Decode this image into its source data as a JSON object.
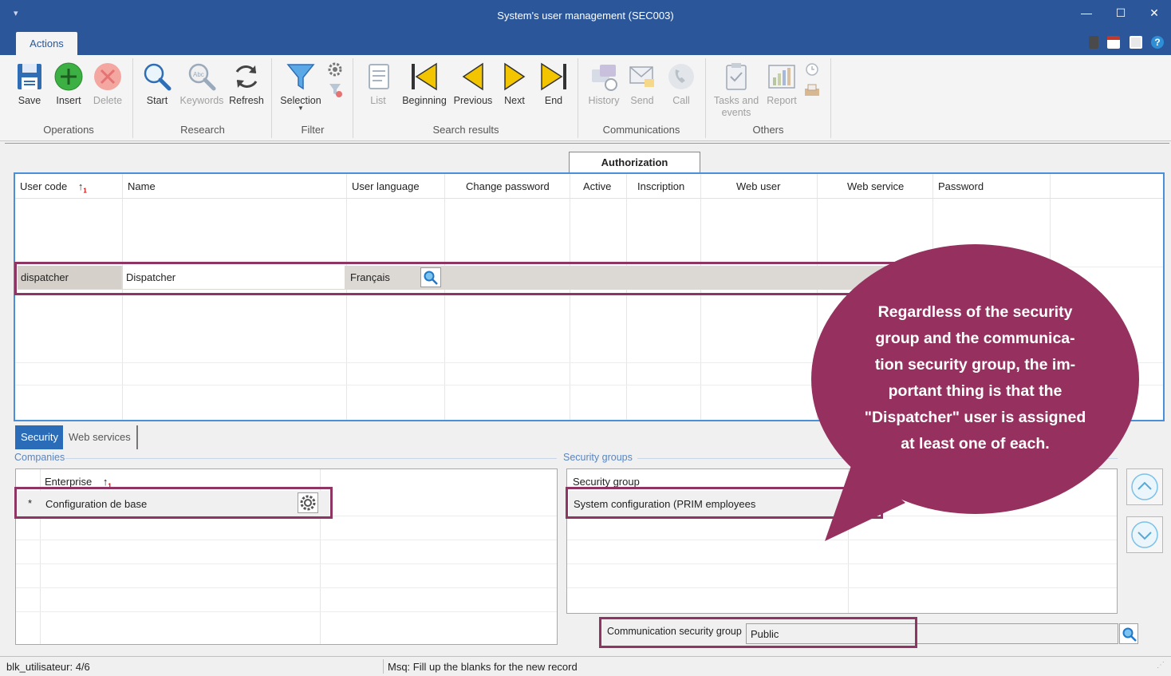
{
  "window": {
    "title": "System's user management (SEC003)"
  },
  "tabs": {
    "actions": "Actions"
  },
  "ribbon": {
    "operations": {
      "save": "Save",
      "insert": "Insert",
      "delete": "Delete",
      "group": "Operations"
    },
    "research": {
      "start": "Start",
      "keywords": "Keywords",
      "refresh": "Refresh",
      "group": "Research"
    },
    "filter": {
      "selection": "Selection",
      "group": "Filter"
    },
    "search_results": {
      "list": "List",
      "beginning": "Beginning",
      "previous": "Previous",
      "next": "Next",
      "end": "End",
      "group": "Search results"
    },
    "communications": {
      "history": "History",
      "send": "Send",
      "call": "Call",
      "group": "Communications"
    },
    "others": {
      "tasks_line1": "Tasks and",
      "tasks_line2": "events",
      "report": "Report",
      "group": "Others"
    }
  },
  "grid": {
    "auth_tab": "Authorization",
    "headers": {
      "user_code": "User code",
      "name": "Name",
      "user_language": "User language",
      "change_password": "Change password",
      "active": "Active",
      "inscription": "Inscription",
      "web_user": "Web user",
      "web_service": "Web service",
      "password": "Password"
    },
    "row": {
      "user_code": "dispatcher",
      "name": "Dispatcher",
      "language": "Français"
    }
  },
  "bottom_tabs": {
    "security": "Security",
    "web_services": "Web services"
  },
  "companies": {
    "section": "Companies",
    "header": "Enterprise",
    "row_marker": "*",
    "row_value": "Configuration de base"
  },
  "security_groups": {
    "section": "Security groups",
    "header": "Security group",
    "row_value": "System configuration (PRIM employees"
  },
  "comm_group": {
    "label": "Communication security group",
    "value": "Public"
  },
  "status": {
    "left": "blk_utilisateur: 4/6",
    "msg": "Msq: Fill up the blanks for the new record"
  },
  "callout": {
    "line1": "Regardless of the security",
    "line2": "group and the communica-",
    "line3": "tion security group, the im-",
    "line4": "portant thing is that the",
    "line5": "\"Dispatcher\" user is assigned",
    "line6": "at least one of each."
  },
  "colors": {
    "titlebar": "#2b579a",
    "callout": "#96305f",
    "highlight_border": "#8e3563",
    "grid_border": "#4a90d9"
  }
}
